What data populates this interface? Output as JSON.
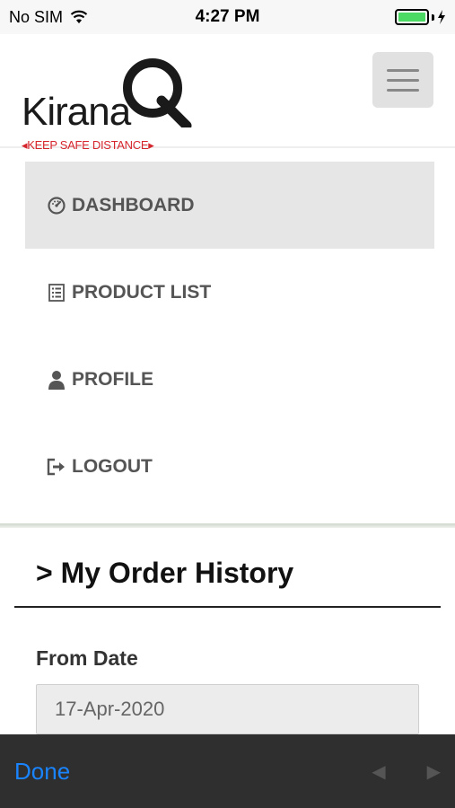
{
  "status_bar": {
    "carrier": "No SIM",
    "time": "4:27 PM",
    "icons": [
      "wifi-icon",
      "battery-icon",
      "charging-bolt-icon"
    ],
    "battery_color": "#4cd964"
  },
  "header": {
    "logo": {
      "word": "Kirana",
      "letter": "Q",
      "tagline": "◂KEEP SAFE DISTANCE▸"
    },
    "menu_icon": "hamburger-menu-icon"
  },
  "nav": {
    "items": [
      {
        "label": "DASHBOARD",
        "icon": "dashboard-gauge-icon",
        "active": true
      },
      {
        "label": "PRODUCT LIST",
        "icon": "list-icon",
        "active": false
      },
      {
        "label": "PROFILE",
        "icon": "user-icon",
        "active": false
      },
      {
        "label": "LOGOUT",
        "icon": "logout-icon",
        "active": false
      }
    ]
  },
  "main": {
    "title": "> My Order History",
    "from_date_label": "From Date",
    "from_date_value": "17-Apr-2020"
  },
  "keyboard_accessory": {
    "done_label": "Done",
    "prev_label": "◀",
    "next_label": "▶"
  },
  "colors": {
    "accent": "#1a84ff",
    "brand_red": "#d6262d",
    "active_nav_bg": "#e6e6e6"
  }
}
